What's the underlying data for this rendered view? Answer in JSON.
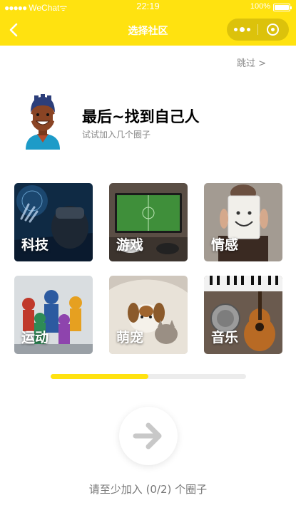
{
  "status_bar": {
    "carrier": "WeChat",
    "time": "22:19",
    "battery": "100%"
  },
  "nav": {
    "title": "选择社区",
    "back_icon": "chevron-left-icon",
    "menu_icon": "more-dots-icon",
    "close_icon": "target-circle-icon"
  },
  "skip_label": "跳过 >",
  "intro": {
    "headline": "最后~找到自己人",
    "subline": "试试加入几个圈子"
  },
  "communities": [
    {
      "label": "科技",
      "theme": "vr-headset"
    },
    {
      "label": "游戏",
      "theme": "tv-gaming"
    },
    {
      "label": "情感",
      "theme": "smiley-paper"
    },
    {
      "label": "运动",
      "theme": "athletes"
    },
    {
      "label": "萌宠",
      "theme": "dog-cat"
    },
    {
      "label": "音乐",
      "theme": "instruments"
    }
  ],
  "progress": {
    "fraction": 0.5
  },
  "next_icon": "arrow-right-icon",
  "hint": "请至少加入 (0/2) 个圈子",
  "colors": {
    "accent": "#FFE210",
    "muted_text": "#888888"
  }
}
